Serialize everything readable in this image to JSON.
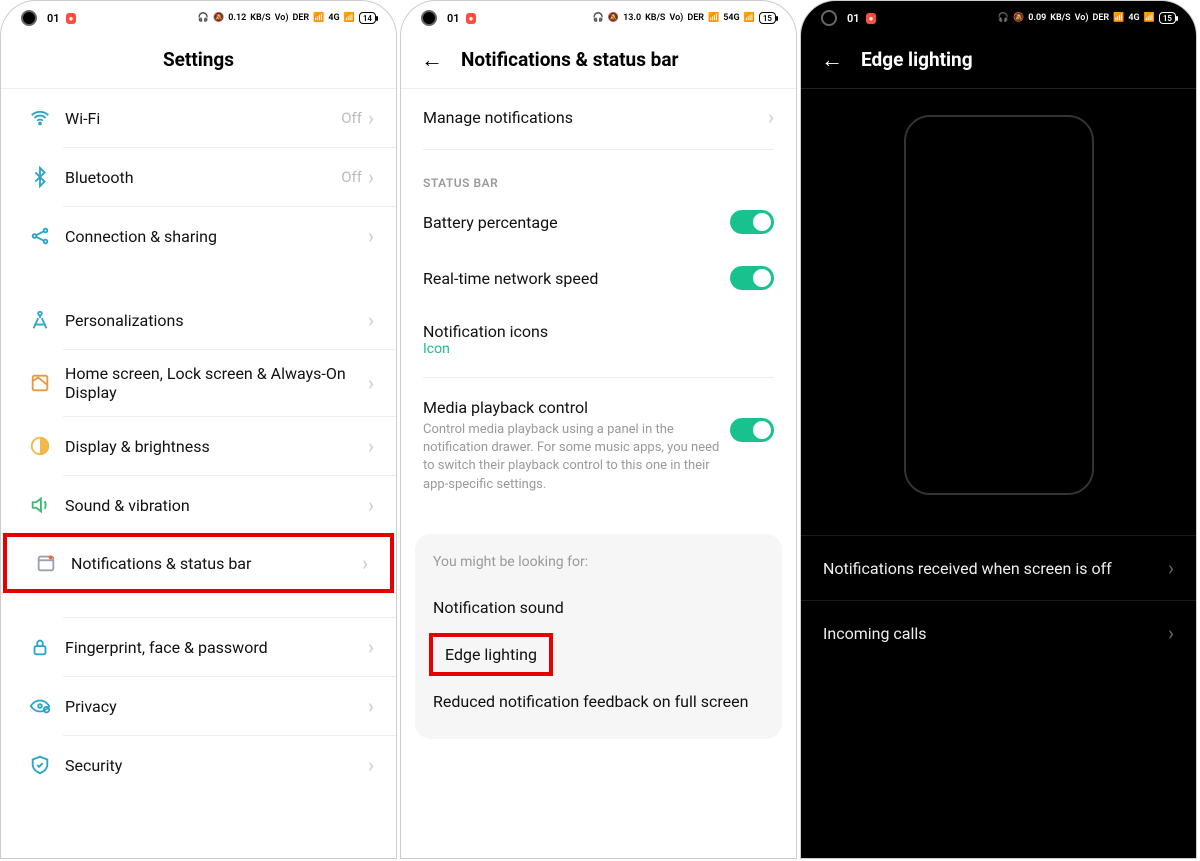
{
  "screens": {
    "settings": {
      "status": {
        "time": "01",
        "rec": "●",
        "speed": "0.12",
        "speed_unit": "KB/S",
        "net1": "Vo)",
        "net2": "DER",
        "sig": "4G",
        "bat": "14"
      },
      "title": "Settings",
      "rows": [
        {
          "icon": "wifi",
          "label": "Wi-Fi",
          "value": "Off"
        },
        {
          "icon": "bluetooth",
          "label": "Bluetooth",
          "value": "Off"
        },
        {
          "icon": "share",
          "label": "Connection & sharing",
          "value": ""
        },
        {
          "icon": "compass",
          "label": "Personalizations",
          "value": ""
        },
        {
          "icon": "home",
          "label": "Home screen, Lock screen & Always-On Display",
          "value": ""
        },
        {
          "icon": "brightness",
          "label": "Display & brightness",
          "value": ""
        },
        {
          "icon": "sound",
          "label": "Sound & vibration",
          "value": ""
        },
        {
          "icon": "notify",
          "label": "Notifications & status bar",
          "value": ""
        },
        {
          "icon": "lock",
          "label": "Fingerprint, face & password",
          "value": ""
        },
        {
          "icon": "privacy",
          "label": "Privacy",
          "value": ""
        },
        {
          "icon": "security",
          "label": "Security",
          "value": ""
        }
      ]
    },
    "notif": {
      "status": {
        "time": "01",
        "rec": "●",
        "speed": "13.0",
        "speed_unit": "KB/S",
        "net1": "Vo)",
        "net2": "DER",
        "sig": "54G",
        "bat": "15"
      },
      "title": "Notifications & status bar",
      "manage": "Manage notifications",
      "section_statusbar": "STATUS BAR",
      "battery_pct": "Battery percentage",
      "net_speed": "Real-time network speed",
      "notif_icons": "Notification icons",
      "notif_icons_sub": "Icon",
      "media_title": "Media playback control",
      "media_sub": "Control media playback using a panel in the notification drawer. For some music apps, you need to switch their playback control to this one in their app-specific settings.",
      "card_hint": "You might be looking for:",
      "card_opts": [
        "Notification sound",
        "Edge lighting",
        "Reduced notification feedback on full screen"
      ]
    },
    "edge": {
      "status": {
        "time": "01",
        "rec": "●",
        "speed": "0.09",
        "speed_unit": "KB/S",
        "net1": "Vo)",
        "net2": "DER",
        "sig": "4G",
        "bat": "15"
      },
      "title": "Edge lighting",
      "rows": [
        "Notifications received when screen is off",
        "Incoming calls"
      ]
    }
  }
}
